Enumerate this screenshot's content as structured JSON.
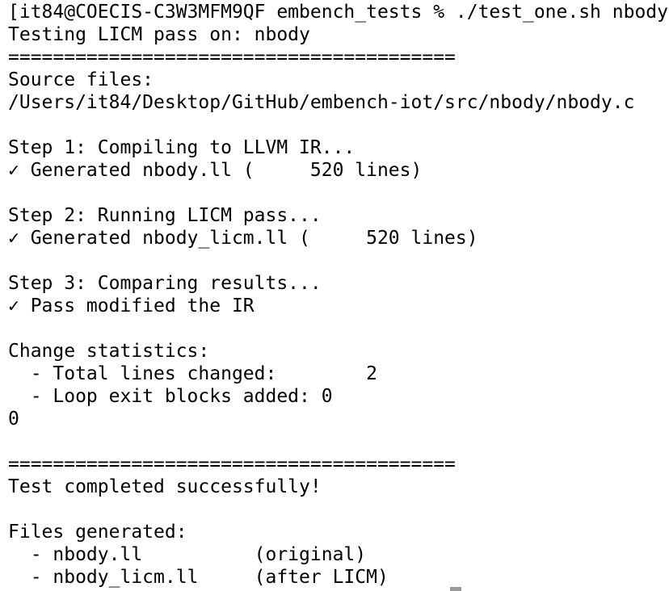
{
  "terminal": {
    "lines": [
      "[it84@COECIS-C3W3MFM9QF embench_tests % ./test_one.sh nbody",
      "Testing LICM pass on: nbody",
      "========================================",
      "Source files:",
      "/Users/it84/Desktop/GitHub/embench-iot/src/nbody/nbody.c",
      "",
      "Step 1: Compiling to LLVM IR...",
      "✓ Generated nbody.ll (     520 lines)",
      "",
      "Step 2: Running LICM pass...",
      "✓ Generated nbody_licm.ll (     520 lines)",
      "",
      "Step 3: Comparing results...",
      "✓ Pass modified the IR",
      "",
      "Change statistics:",
      "  - Total lines changed:        2",
      "  - Loop exit blocks added: 0",
      "0",
      "",
      "========================================",
      "Test completed successfully!",
      "",
      "Files generated:",
      "  - nbody.ll          (original)",
      "  - nbody_licm.ll     (after LICM)"
    ]
  }
}
